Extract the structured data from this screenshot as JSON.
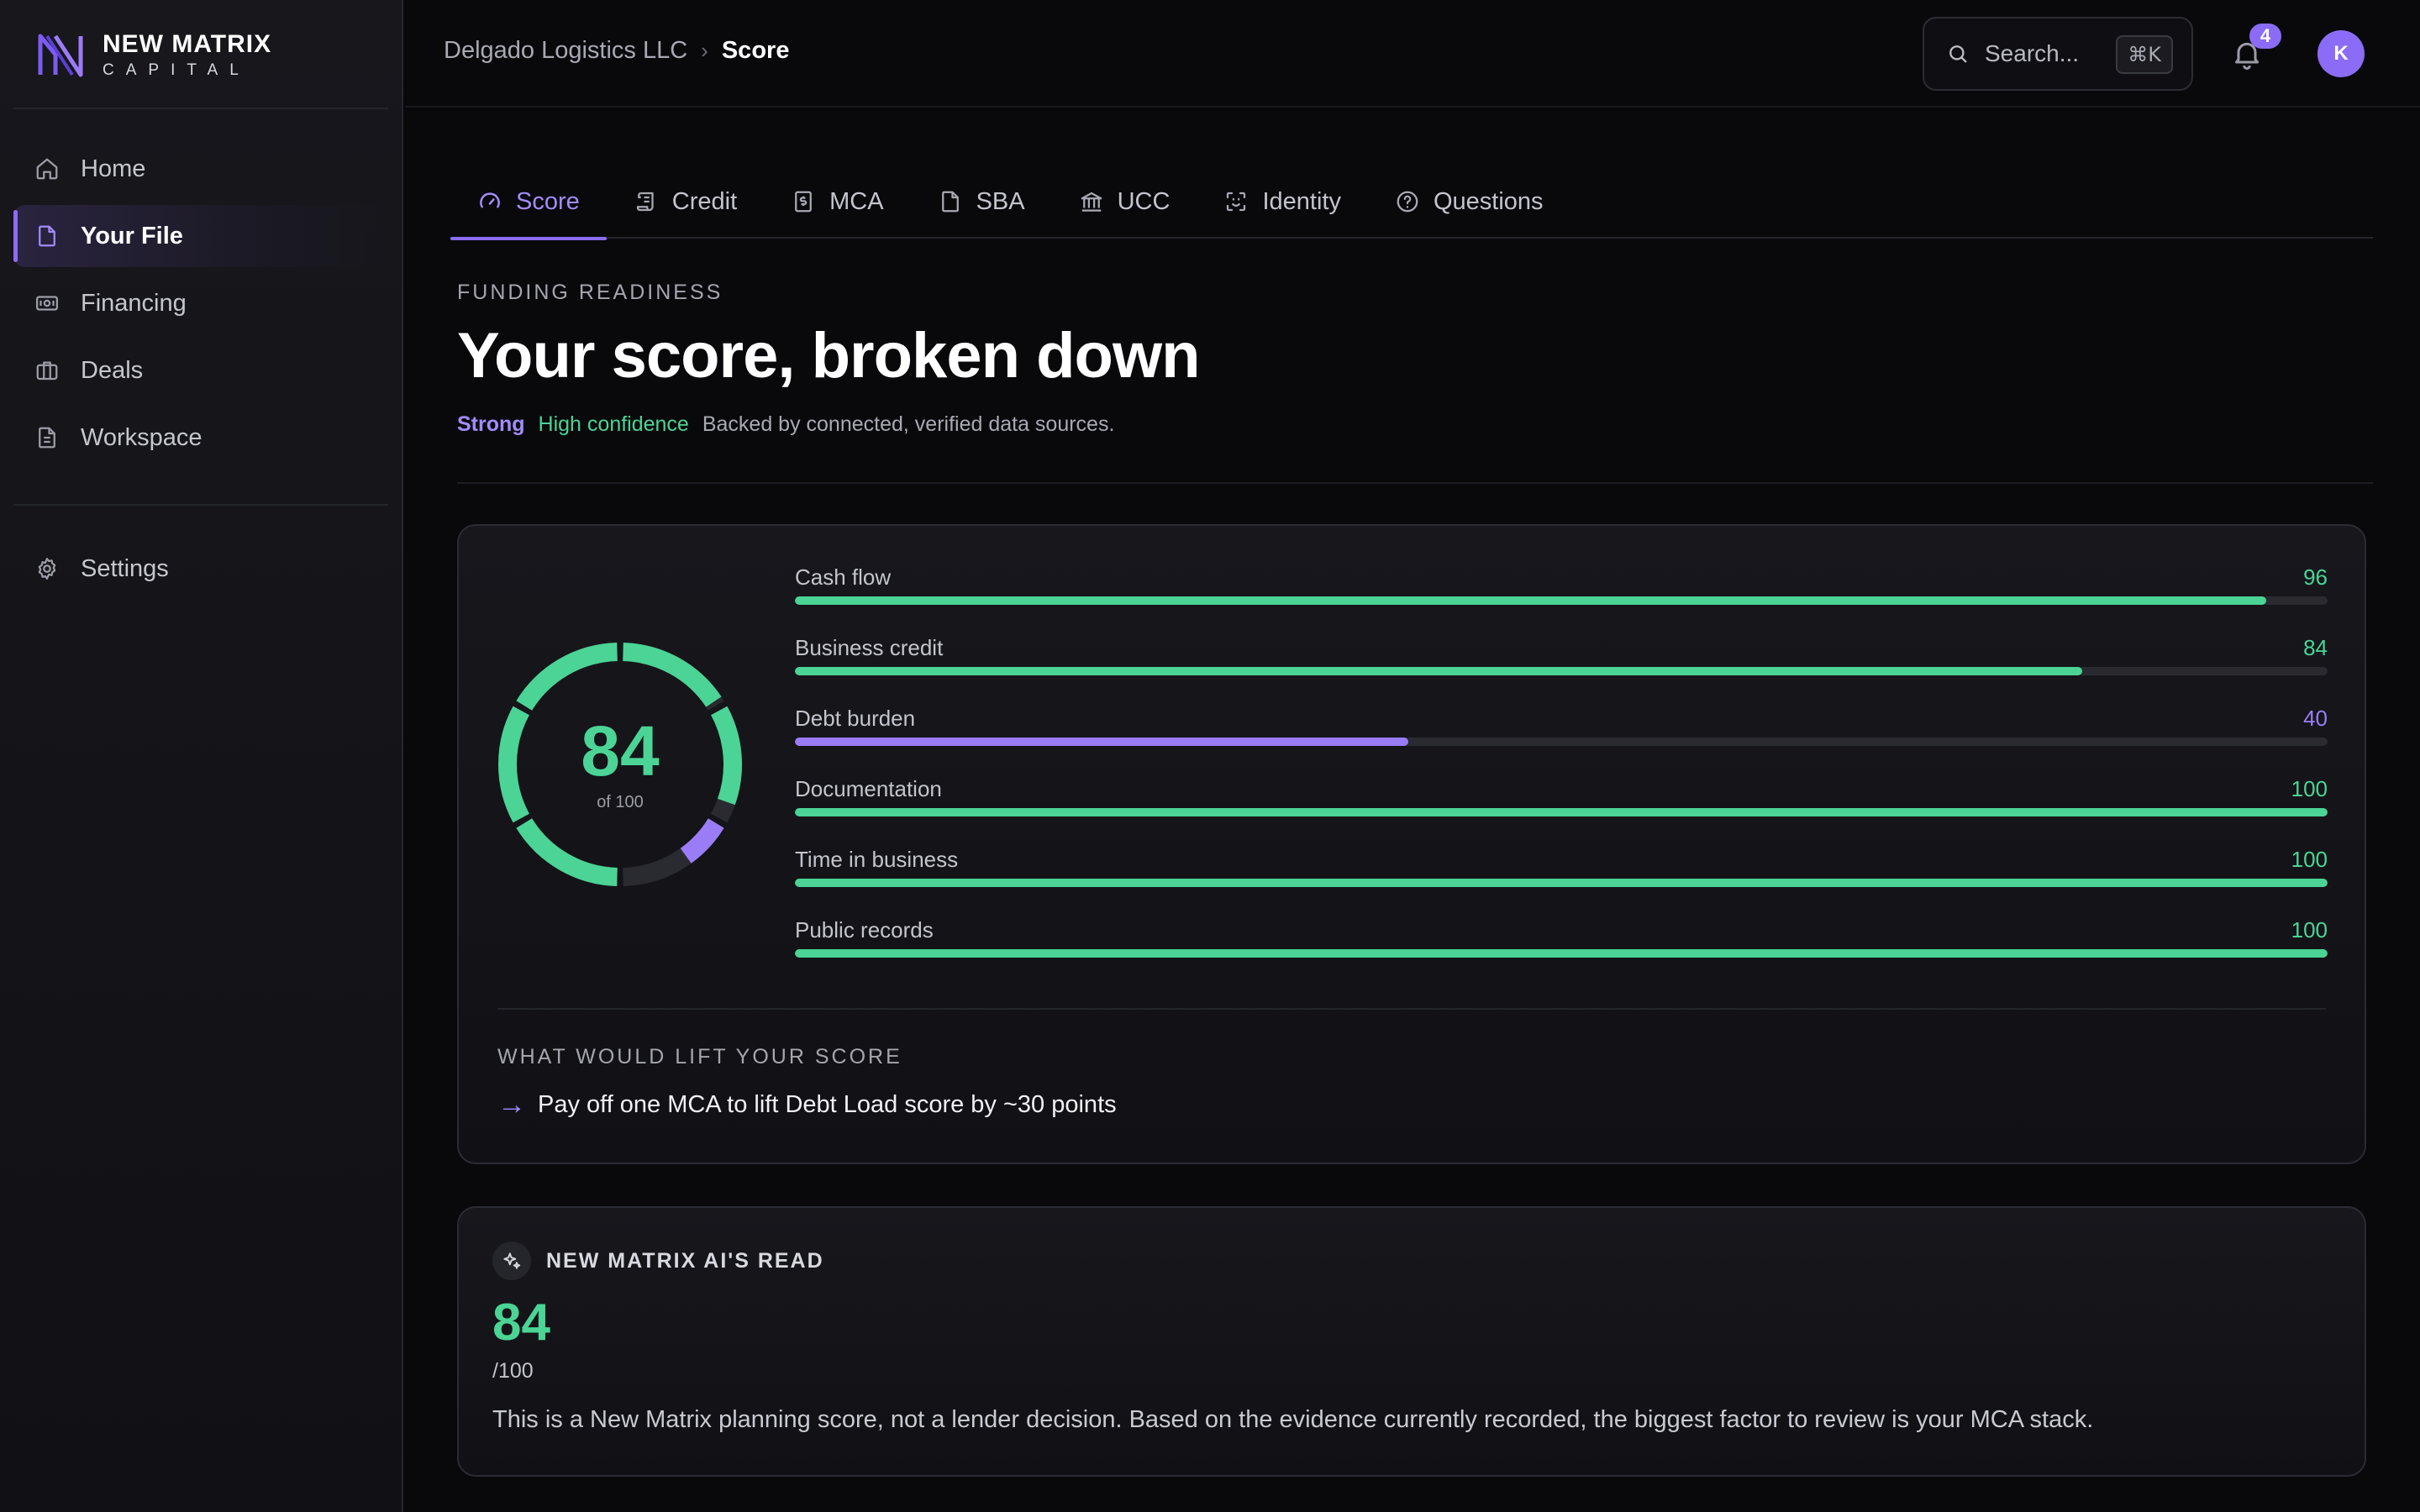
{
  "brand": {
    "name": "NEW MATRIX",
    "sub": "CAPITAL",
    "accent": "#8b6cf6"
  },
  "sidebar": {
    "items": [
      {
        "label": "Home",
        "icon": "home-icon",
        "active": false
      },
      {
        "label": "Your File",
        "icon": "file-icon",
        "active": true
      },
      {
        "label": "Financing",
        "icon": "banknote-icon",
        "active": false
      },
      {
        "label": "Deals",
        "icon": "briefcase-icon",
        "active": false
      },
      {
        "label": "Workspace",
        "icon": "document-icon",
        "active": false
      }
    ],
    "settings_label": "Settings"
  },
  "topbar": {
    "breadcrumb_parent": "Delgado Logistics LLC",
    "breadcrumb_sep": "›",
    "breadcrumb_current": "Score",
    "search_placeholder": "Search...",
    "search_shortcut": "⌘K",
    "notification_count": "4",
    "avatar_initial": "K"
  },
  "tabs": [
    {
      "label": "Score",
      "icon": "gauge-icon",
      "active": true
    },
    {
      "label": "Credit",
      "icon": "scroll-icon",
      "active": false
    },
    {
      "label": "MCA",
      "icon": "dollar-doc-icon",
      "active": false
    },
    {
      "label": "SBA",
      "icon": "file-icon",
      "active": false
    },
    {
      "label": "UCC",
      "icon": "bank-icon",
      "active": false
    },
    {
      "label": "Identity",
      "icon": "scan-face-icon",
      "active": false
    },
    {
      "label": "Questions",
      "icon": "help-circle-icon",
      "active": false
    }
  ],
  "heading": {
    "eyebrow": "FUNDING READINESS",
    "title": "Your score, broken down",
    "strength": "Strong",
    "confidence": "High confidence",
    "description": "Backed by connected, verified data sources."
  },
  "score": {
    "value": "84",
    "of_label": "of 100",
    "colors": {
      "good": "#4bd495",
      "warn": "#9b7cf7",
      "track": "#2a2a31"
    },
    "metrics": [
      {
        "label": "Cash flow",
        "value": 96,
        "status": "good"
      },
      {
        "label": "Business credit",
        "value": 84,
        "status": "good"
      },
      {
        "label": "Debt burden",
        "value": 40,
        "status": "warn"
      },
      {
        "label": "Documentation",
        "value": 100,
        "status": "good"
      },
      {
        "label": "Time in business",
        "value": 100,
        "status": "good"
      },
      {
        "label": "Public records",
        "value": 100,
        "status": "good"
      }
    ],
    "lift_heading": "WHAT WOULD LIFT YOUR SCORE",
    "lift_items": [
      {
        "arrow": "→",
        "text": "Pay off one MCA to lift Debt Load score by ~30 points"
      }
    ]
  },
  "ai_read": {
    "title": "NEW MATRIX AI'S READ",
    "score": "84",
    "denominator": "/100",
    "text": "This is a New Matrix planning score, not a lender decision. Based on the evidence currently recorded, the biggest factor to review is your MCA stack."
  }
}
